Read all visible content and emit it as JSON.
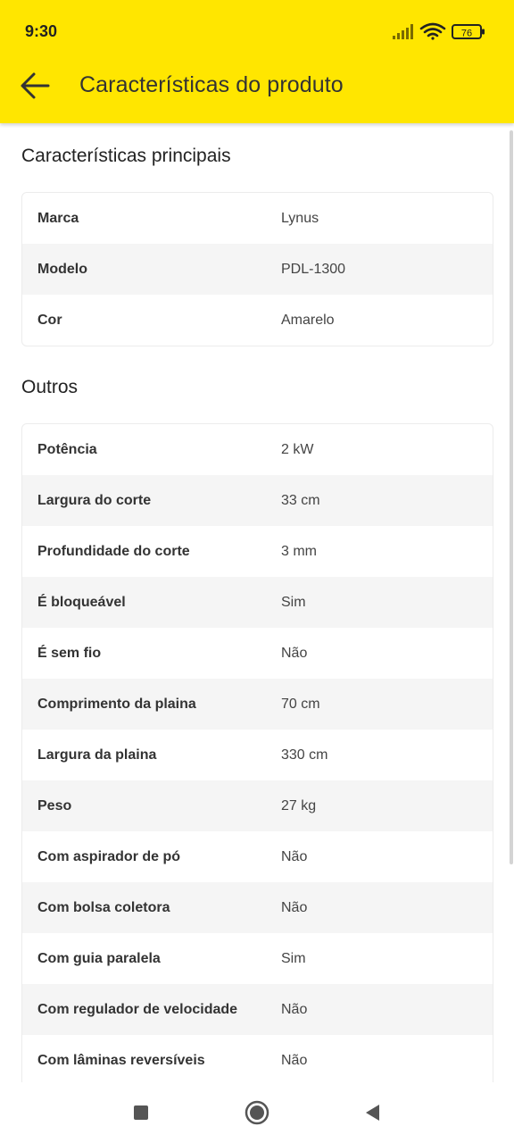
{
  "status_bar": {
    "time": "9:30",
    "battery_level": "76",
    "icons": [
      "signal-icon",
      "wifi-icon",
      "battery-icon"
    ]
  },
  "app_bar": {
    "title": "Características do produto",
    "back_icon": "arrow-left-icon",
    "background_color": "#FFE600"
  },
  "sections": [
    {
      "title": "Características principais",
      "rows": [
        {
          "label": "Marca",
          "value": "Lynus"
        },
        {
          "label": "Modelo",
          "value": "PDL-1300"
        },
        {
          "label": "Cor",
          "value": "Amarelo"
        }
      ]
    },
    {
      "title": "Outros",
      "rows": [
        {
          "label": "Potência",
          "value": "2 kW"
        },
        {
          "label": "Largura do corte",
          "value": "33 cm"
        },
        {
          "label": "Profundidade do corte",
          "value": "3 mm"
        },
        {
          "label": "É bloqueável",
          "value": "Sim"
        },
        {
          "label": "É sem fio",
          "value": "Não"
        },
        {
          "label": "Comprimento da plaina",
          "value": "70 cm"
        },
        {
          "label": "Largura da plaina",
          "value": "330 cm"
        },
        {
          "label": "Peso",
          "value": "27 kg"
        },
        {
          "label": "Com aspirador de pó",
          "value": "Não"
        },
        {
          "label": "Com bolsa coletora",
          "value": "Não"
        },
        {
          "label": "Com guia paralela",
          "value": "Sim"
        },
        {
          "label": "Com regulador de velocidade",
          "value": "Não"
        },
        {
          "label": "Com lâminas reversíveis",
          "value": "Não"
        }
      ]
    }
  ],
  "nav_bar": {
    "icons": [
      "recent-apps-icon",
      "home-icon",
      "back-triangle-icon"
    ]
  }
}
